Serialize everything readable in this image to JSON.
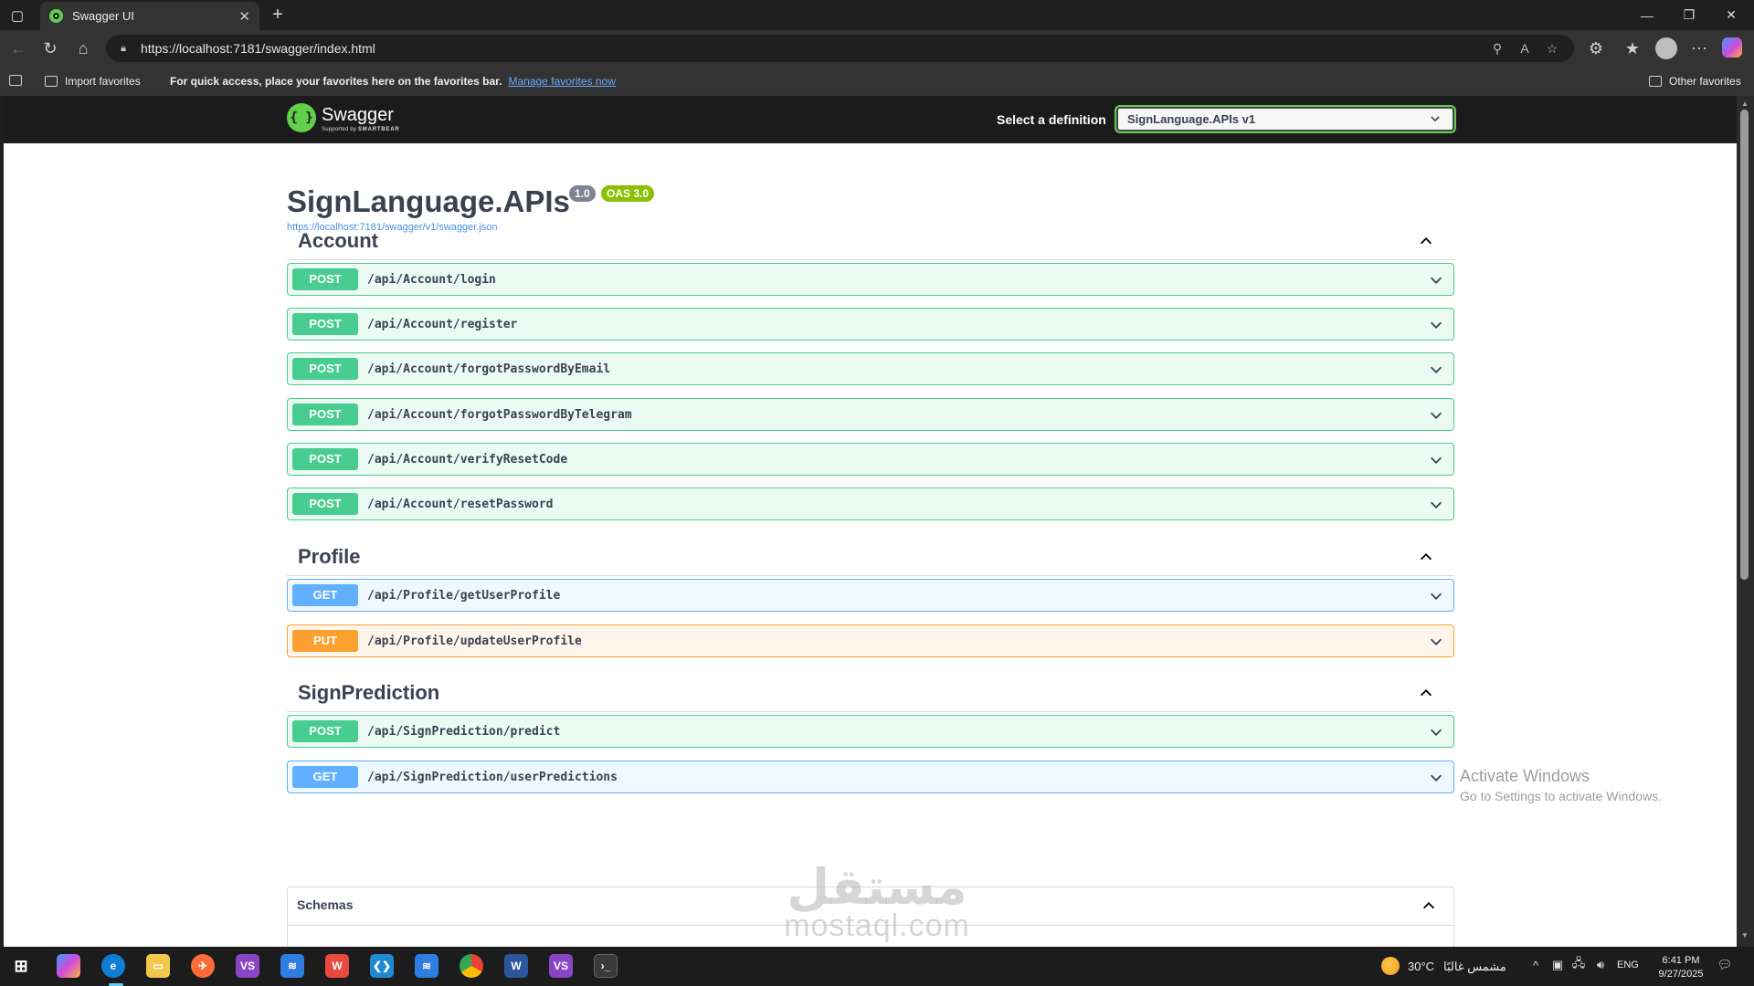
{
  "browser": {
    "tab_title": "Swagger UI",
    "url": "https://localhost:7181/swagger/index.html",
    "favorites": {
      "import_label": "Import favorites",
      "hint": "For quick access, place your favorites here on the favorites bar.",
      "manage_link": "Manage favorites now",
      "other_label": "Other favorites"
    }
  },
  "swagger": {
    "brand": "Swagger",
    "brand_sub_prefix": "Supported by",
    "brand_sub_name": "SMARTBEAR",
    "definition_label": "Select a definition",
    "definition_value": "SignLanguage.APIs v1",
    "title": "SignLanguage.APIs",
    "version_badge": "1.0",
    "oas_badge": "OAS 3.0",
    "spec_url": "https://localhost:7181/swagger/v1/swagger.json",
    "tags": [
      {
        "name": "Account",
        "operations": [
          {
            "method": "POST",
            "path": "/api/Account/login"
          },
          {
            "method": "POST",
            "path": "/api/Account/register"
          },
          {
            "method": "POST",
            "path": "/api/Account/forgotPasswordByEmail"
          },
          {
            "method": "POST",
            "path": "/api/Account/forgotPasswordByTelegram"
          },
          {
            "method": "POST",
            "path": "/api/Account/verifyResetCode"
          },
          {
            "method": "POST",
            "path": "/api/Account/resetPassword"
          }
        ]
      },
      {
        "name": "Profile",
        "operations": [
          {
            "method": "GET",
            "path": "/api/Profile/getUserProfile"
          },
          {
            "method": "PUT",
            "path": "/api/Profile/updateUserProfile"
          }
        ]
      },
      {
        "name": "SignPrediction",
        "operations": [
          {
            "method": "POST",
            "path": "/api/SignPrediction/predict"
          },
          {
            "method": "GET",
            "path": "/api/SignPrediction/userPredictions"
          }
        ]
      }
    ],
    "schemas_label": "Schemas",
    "colors": {
      "post": "#49cc90",
      "get": "#61affe",
      "put": "#fca130",
      "brand_green": "#62d04b"
    }
  },
  "overlay": {
    "activate_title": "Activate Windows",
    "activate_sub": "Go to Settings to activate Windows.",
    "watermark_ar": "مستقل",
    "watermark_en": "mostaql.com"
  },
  "taskbar": {
    "weather_temp": "30°C",
    "weather_desc": "مشمس غالبًا",
    "lang": "ENG",
    "time": "6:41 PM",
    "date": "9/27/2025"
  }
}
